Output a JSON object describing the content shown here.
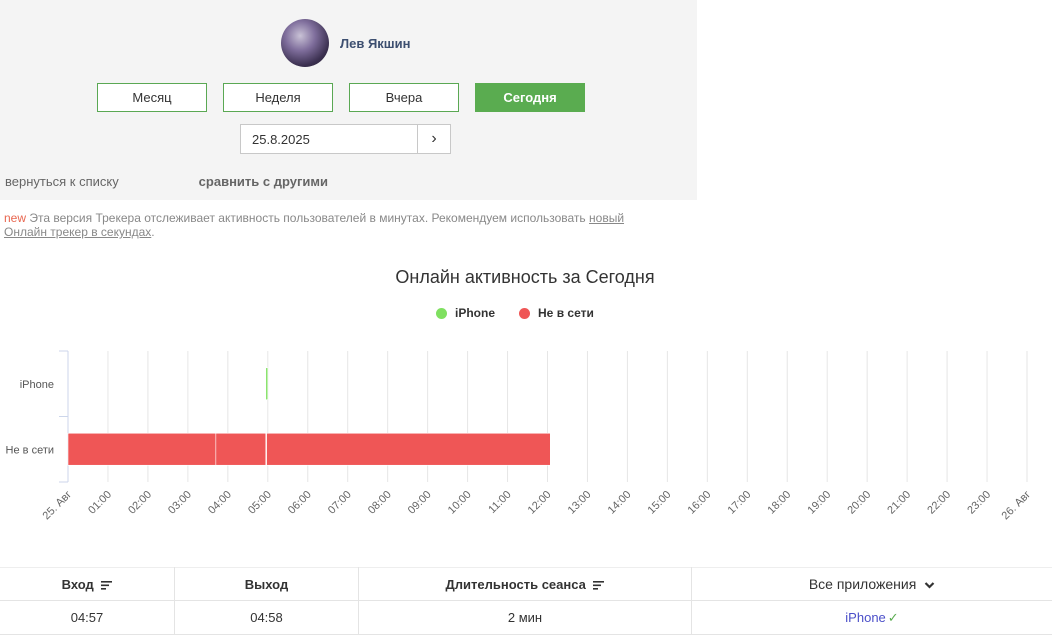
{
  "user": {
    "name": "Лев Якшин"
  },
  "periods": [
    {
      "label": "Месяц",
      "active": false
    },
    {
      "label": "Неделя",
      "active": false
    },
    {
      "label": "Вчера",
      "active": false
    },
    {
      "label": "Сегодня",
      "active": true
    }
  ],
  "date_picker": {
    "value": "25.8.2025",
    "next_glyph": "›"
  },
  "links": {
    "back": "вернуться к списку",
    "compare": "сравнить с другими"
  },
  "notice": {
    "new_tag": "new",
    "text": " Эта версия Трекера отслеживает активность пользователей в минутах. Рекомендуем использовать ",
    "link": "новый Онлайн трекер в секундах",
    "tail": "."
  },
  "colors": {
    "accent": "#5aac50",
    "iphone": "#7fe060",
    "offline": "#ef5656"
  },
  "chart_data": {
    "type": "timeline",
    "title": "Онлайн активность за Сегодня",
    "categories": [
      "iPhone",
      "Не в сети"
    ],
    "legend": [
      {
        "name": "iPhone",
        "color": "#7fe060"
      },
      {
        "name": "Не в сети",
        "color": "#ef5656"
      }
    ],
    "x_ticks": [
      "25. Авг",
      "01:00",
      "02:00",
      "03:00",
      "04:00",
      "05:00",
      "06:00",
      "07:00",
      "08:00",
      "09:00",
      "10:00",
      "11:00",
      "12:00",
      "13:00",
      "14:00",
      "15:00",
      "16:00",
      "17:00",
      "18:00",
      "19:00",
      "20:00",
      "21:00",
      "22:00",
      "23:00",
      "26. Авг"
    ],
    "x_range_hours": [
      0,
      24
    ],
    "series": [
      {
        "name": "iPhone",
        "segments": [
          [
            4.95,
            4.97
          ]
        ]
      },
      {
        "name": "Не в сети",
        "segments": [
          [
            0,
            3.7
          ],
          [
            3.7,
            4.95
          ],
          [
            4.97,
            12.07
          ]
        ]
      }
    ],
    "grid": true
  },
  "sessions": {
    "headers": {
      "login": "Вход",
      "logout": "Выход",
      "duration": "Длительность сеанса",
      "apps": "Все приложения"
    },
    "rows": [
      {
        "login": "04:57",
        "logout": "04:58",
        "duration": "2 мин",
        "app": "iPhone",
        "mark": "✓"
      }
    ]
  }
}
